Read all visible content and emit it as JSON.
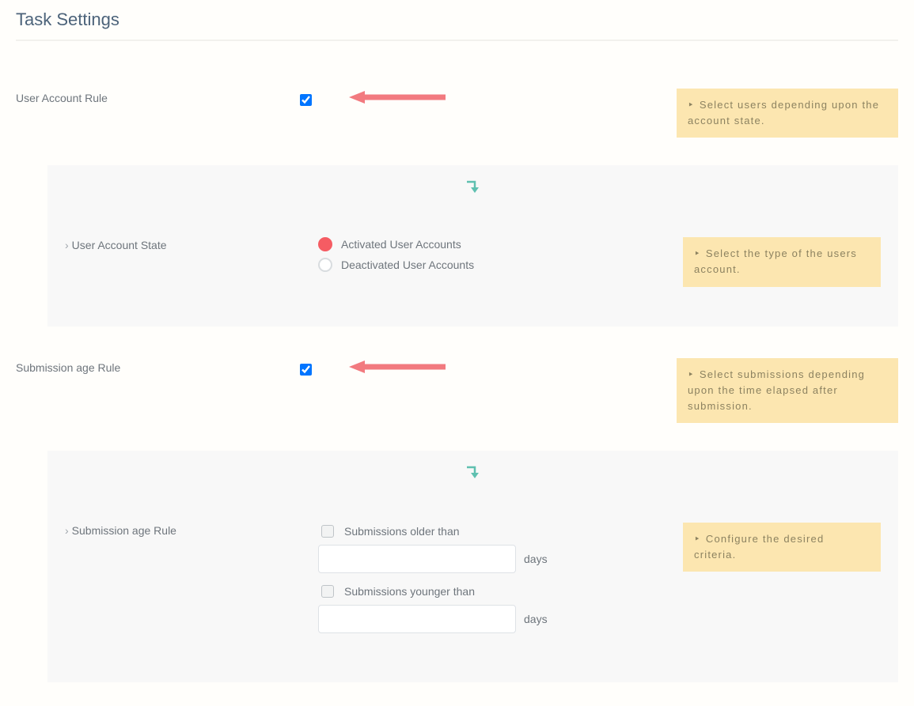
{
  "title": "Task Settings",
  "rules": {
    "user_account": {
      "label": "User Account Rule",
      "checked": true,
      "help": "Select users depending upon the account state.",
      "sub_label": "User Account State",
      "sub_help": "Select the type of the users account.",
      "option_activated": "Activated User Accounts",
      "option_deactivated": "Deactivated User Accounts"
    },
    "submission_age": {
      "label": "Submission age Rule",
      "checked": true,
      "help": "Select submissions depending upon the time elapsed after submission.",
      "sub_label": "Submission age Rule",
      "sub_help": "Configure the desired criteria.",
      "older_label": "Submissions older than",
      "younger_label": "Submissions younger than",
      "unit": "days",
      "older_value": "",
      "younger_value": ""
    }
  },
  "icons": {
    "bullet": "‣",
    "chevron": "›"
  },
  "colors": {
    "help_bg": "#fce6b0",
    "panel_bg": "#f8f8f8",
    "arrow_red": "#f27a7f",
    "arrow_teal": "#5fc0b0"
  }
}
